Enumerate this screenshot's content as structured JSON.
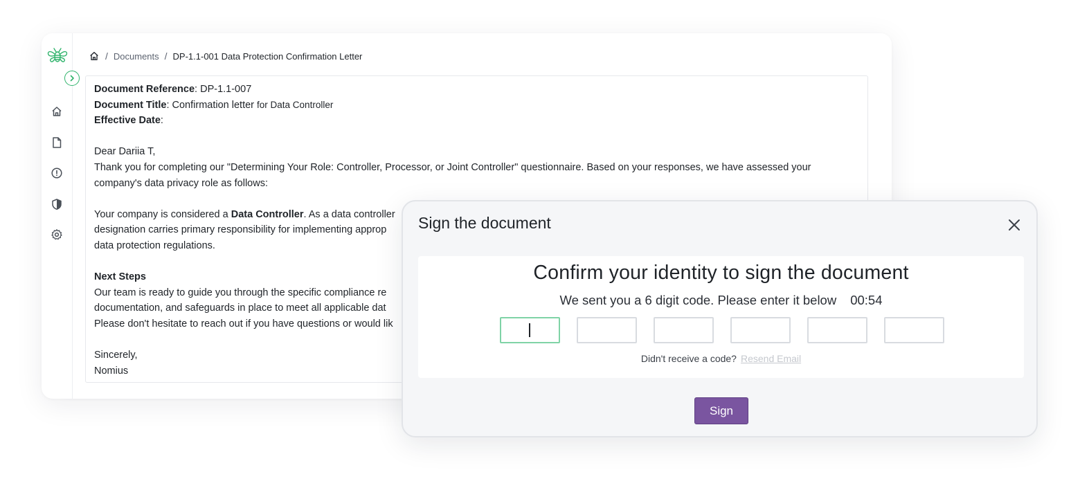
{
  "breadcrumb": {
    "home_icon": "home-icon",
    "separator": "/",
    "documents": "Documents",
    "current": "DP-1.1-001 Data Protection Confirmation Letter"
  },
  "sidebar": {
    "logo": "bee-logo",
    "items": [
      {
        "icon": "home-icon"
      },
      {
        "icon": "document-icon"
      },
      {
        "icon": "alert-circle-icon"
      },
      {
        "icon": "shield-icon"
      },
      {
        "icon": "gear-icon"
      }
    ]
  },
  "document": {
    "ref_label": "Document Reference",
    "ref_value": ": DP-1.1-007",
    "title_label": "Document Title",
    "title_value": ": Confirmation letter ",
    "title_value_small": "for Data Controller",
    "date_label": "Effective Date",
    "date_value": ":",
    "greeting": "Dear Dariia T,",
    "intro": "Thank you for completing our \"Determining Your Role: Controller, Processor, or Joint Controller\" questionnaire. Based on your responses, we have assessed your company's data privacy role as follows:",
    "role_prefix": "Your company is considered a ",
    "role_bold": "Data Controller",
    "role_line1_rest": ". As a data controller",
    "role_line2": "designation carries primary responsibility for implementing approp",
    "role_line3": "data protection regulations.",
    "next_steps_heading": "Next Steps",
    "next_line1": "Our team is ready to guide you through the specific compliance re",
    "next_line2": "documentation, and safeguards in place to meet all applicable dat",
    "next_line3": "Please don't hesitate to reach out if you have questions or would lik",
    "closing": "Sincerely,",
    "signature": "Nomius"
  },
  "modal": {
    "title": "Sign the document",
    "heading": "Confirm your identity to sign the document",
    "subtitle": "We sent you a 6 digit code. Please enter it below",
    "timer": "00:54",
    "code_values": [
      "",
      "",
      "",
      "",
      "",
      ""
    ],
    "resend_prompt": "Didn't receive a code?",
    "resend_link": "Resend Email",
    "sign_label": "Sign"
  },
  "colors": {
    "accent_green": "#2fb36b",
    "active_box_border": "#7fd3a6",
    "sign_button": "#7a55a0",
    "resend_link": "#c5c8ce"
  }
}
